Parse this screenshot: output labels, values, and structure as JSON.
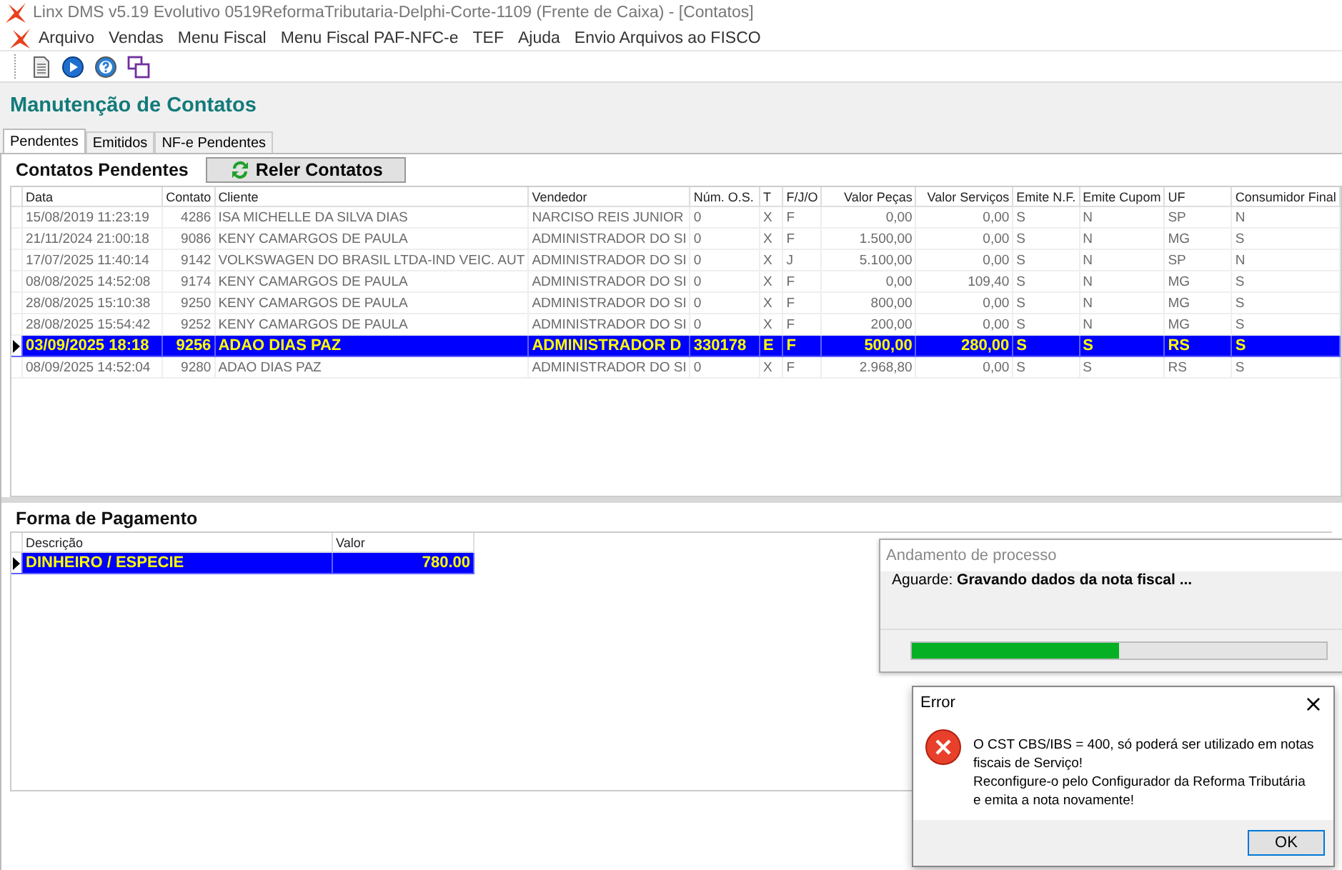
{
  "window": {
    "title": "Linx DMS v5.19 Evolutivo 0519ReformaTributaria-Delphi-Corte-1109 (Frente de Caixa) - [Contatos]"
  },
  "menu": [
    "Arquivo",
    "Vendas",
    "Menu Fiscal",
    "Menu Fiscal PAF-NFC-e",
    "TEF",
    "Ajuda",
    "Envio Arquivos ao FISCO"
  ],
  "page_title": "Manutenção de Contatos",
  "tabs": [
    {
      "label": "Pendentes",
      "selected": true
    },
    {
      "label": "Emitidos",
      "selected": false
    },
    {
      "label": "NF-e Pendentes",
      "selected": false
    }
  ],
  "section_title": "Contatos Pendentes",
  "reload_button": "Reler Contatos",
  "contacts_table": {
    "columns": [
      "Data",
      "Contato",
      "Cliente",
      "Vendedor",
      "Núm. O.S.",
      "T",
      "F/J/O",
      "Valor Peças",
      "Valor Serviços",
      "Emite N.F.",
      "Emite Cupom",
      "UF",
      "Consumidor Final"
    ],
    "rows": [
      {
        "selected": false,
        "cells": [
          "15/08/2019 11:23:19",
          "4286",
          "ISA MICHELLE DA SILVA DIAS",
          "NARCISO REIS JUNIOR",
          "0",
          "X",
          "F",
          "0,00",
          "0,00",
          "S",
          "N",
          "SP",
          "N"
        ]
      },
      {
        "selected": false,
        "cells": [
          "21/11/2024 21:00:18",
          "9086",
          "KENY CAMARGOS DE PAULA",
          "ADMINISTRADOR DO SI",
          "0",
          "X",
          "F",
          "1.500,00",
          "0,00",
          "S",
          "N",
          "MG",
          "S"
        ]
      },
      {
        "selected": false,
        "cells": [
          "17/07/2025 11:40:14",
          "9142",
          "VOLKSWAGEN DO BRASIL LTDA-IND VEIC. AUT",
          "ADMINISTRADOR DO SI",
          "0",
          "X",
          "J",
          "5.100,00",
          "0,00",
          "S",
          "N",
          "SP",
          "N"
        ]
      },
      {
        "selected": false,
        "cells": [
          "08/08/2025 14:52:08",
          "9174",
          "KENY CAMARGOS DE PAULA",
          "ADMINISTRADOR DO SI",
          "0",
          "X",
          "F",
          "0,00",
          "109,40",
          "S",
          "N",
          "MG",
          "S"
        ]
      },
      {
        "selected": false,
        "cells": [
          "28/08/2025 15:10:38",
          "9250",
          "KENY CAMARGOS DE PAULA",
          "ADMINISTRADOR DO SI",
          "0",
          "X",
          "F",
          "800,00",
          "0,00",
          "S",
          "N",
          "MG",
          "S"
        ]
      },
      {
        "selected": false,
        "cells": [
          "28/08/2025 15:54:42",
          "9252",
          "KENY CAMARGOS DE PAULA",
          "ADMINISTRADOR DO SI",
          "0",
          "X",
          "F",
          "200,00",
          "0,00",
          "S",
          "N",
          "MG",
          "S"
        ]
      },
      {
        "selected": true,
        "cells": [
          "03/09/2025 18:18",
          "9256",
          "ADAO DIAS PAZ",
          "ADMINISTRADOR D",
          "330178",
          "E",
          "F",
          "500,00",
          "280,00",
          "S",
          "S",
          "RS",
          "S"
        ]
      },
      {
        "selected": false,
        "cells": [
          "08/09/2025 14:52:04",
          "9280",
          "ADAO DIAS PAZ",
          "ADMINISTRADOR DO SI",
          "0",
          "X",
          "F",
          "2.968,80",
          "0,00",
          "S",
          "S",
          "RS",
          "S"
        ]
      }
    ]
  },
  "payment_title": "Forma de Pagamento",
  "payment_table": {
    "columns": [
      "Descrição",
      "Valor"
    ],
    "rows": [
      {
        "selected": true,
        "cells": [
          "DINHEIRO / ESPECIE",
          "780.00"
        ]
      }
    ]
  },
  "progress_dialog": {
    "title": "Andamento de processo",
    "message": "Aguarde: **Gravando dados da nota fiscal ...**",
    "level": 0.5
  },
  "error_dialog": {
    "title": "Error",
    "close": "×",
    "message_lines": [
      "O CST CBS/IBS = 400, só poderá ser utilizado em notas",
      "fiscais de Serviço!",
      "Reconfigure-o pelo Configurador da Reforma Tributária",
      "e emita a nota novamente!"
    ],
    "button": "OK"
  }
}
